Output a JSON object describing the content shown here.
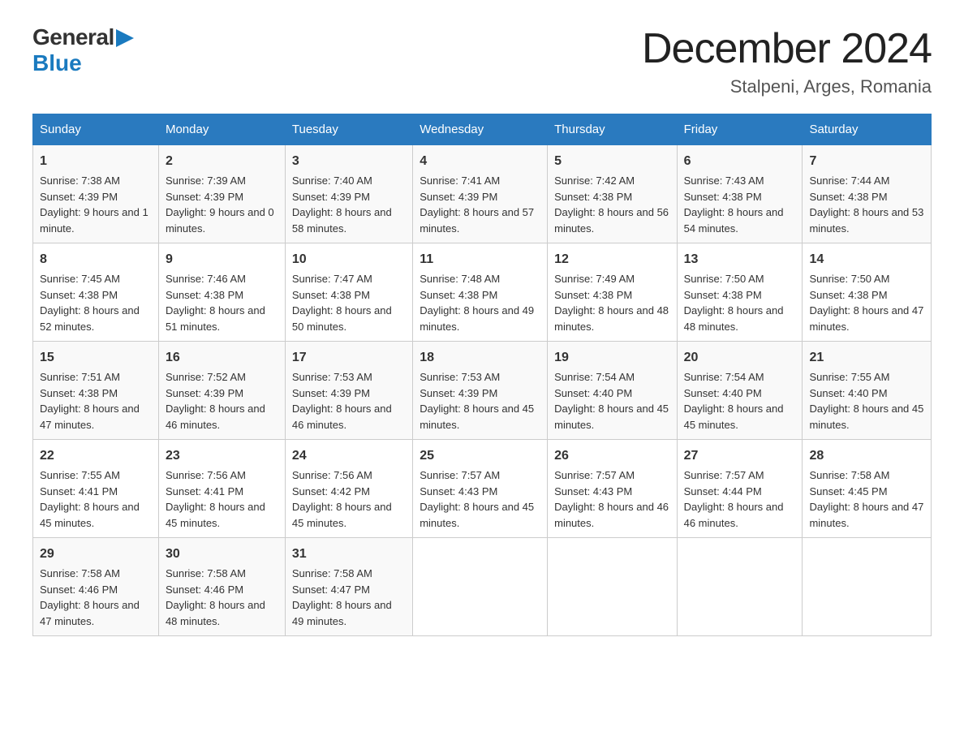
{
  "header": {
    "logo": {
      "general": "General",
      "blue": "Blue",
      "arrow": "▶"
    },
    "title": "December 2024",
    "location": "Stalpeni, Arges, Romania"
  },
  "days_of_week": [
    "Sunday",
    "Monday",
    "Tuesday",
    "Wednesday",
    "Thursday",
    "Friday",
    "Saturday"
  ],
  "weeks": [
    [
      {
        "day": "1",
        "sunrise": "7:38 AM",
        "sunset": "4:39 PM",
        "daylight": "9 hours and 1 minute."
      },
      {
        "day": "2",
        "sunrise": "7:39 AM",
        "sunset": "4:39 PM",
        "daylight": "9 hours and 0 minutes."
      },
      {
        "day": "3",
        "sunrise": "7:40 AM",
        "sunset": "4:39 PM",
        "daylight": "8 hours and 58 minutes."
      },
      {
        "day": "4",
        "sunrise": "7:41 AM",
        "sunset": "4:39 PM",
        "daylight": "8 hours and 57 minutes."
      },
      {
        "day": "5",
        "sunrise": "7:42 AM",
        "sunset": "4:38 PM",
        "daylight": "8 hours and 56 minutes."
      },
      {
        "day": "6",
        "sunrise": "7:43 AM",
        "sunset": "4:38 PM",
        "daylight": "8 hours and 54 minutes."
      },
      {
        "day": "7",
        "sunrise": "7:44 AM",
        "sunset": "4:38 PM",
        "daylight": "8 hours and 53 minutes."
      }
    ],
    [
      {
        "day": "8",
        "sunrise": "7:45 AM",
        "sunset": "4:38 PM",
        "daylight": "8 hours and 52 minutes."
      },
      {
        "day": "9",
        "sunrise": "7:46 AM",
        "sunset": "4:38 PM",
        "daylight": "8 hours and 51 minutes."
      },
      {
        "day": "10",
        "sunrise": "7:47 AM",
        "sunset": "4:38 PM",
        "daylight": "8 hours and 50 minutes."
      },
      {
        "day": "11",
        "sunrise": "7:48 AM",
        "sunset": "4:38 PM",
        "daylight": "8 hours and 49 minutes."
      },
      {
        "day": "12",
        "sunrise": "7:49 AM",
        "sunset": "4:38 PM",
        "daylight": "8 hours and 48 minutes."
      },
      {
        "day": "13",
        "sunrise": "7:50 AM",
        "sunset": "4:38 PM",
        "daylight": "8 hours and 48 minutes."
      },
      {
        "day": "14",
        "sunrise": "7:50 AM",
        "sunset": "4:38 PM",
        "daylight": "8 hours and 47 minutes."
      }
    ],
    [
      {
        "day": "15",
        "sunrise": "7:51 AM",
        "sunset": "4:38 PM",
        "daylight": "8 hours and 47 minutes."
      },
      {
        "day": "16",
        "sunrise": "7:52 AM",
        "sunset": "4:39 PM",
        "daylight": "8 hours and 46 minutes."
      },
      {
        "day": "17",
        "sunrise": "7:53 AM",
        "sunset": "4:39 PM",
        "daylight": "8 hours and 46 minutes."
      },
      {
        "day": "18",
        "sunrise": "7:53 AM",
        "sunset": "4:39 PM",
        "daylight": "8 hours and 45 minutes."
      },
      {
        "day": "19",
        "sunrise": "7:54 AM",
        "sunset": "4:40 PM",
        "daylight": "8 hours and 45 minutes."
      },
      {
        "day": "20",
        "sunrise": "7:54 AM",
        "sunset": "4:40 PM",
        "daylight": "8 hours and 45 minutes."
      },
      {
        "day": "21",
        "sunrise": "7:55 AM",
        "sunset": "4:40 PM",
        "daylight": "8 hours and 45 minutes."
      }
    ],
    [
      {
        "day": "22",
        "sunrise": "7:55 AM",
        "sunset": "4:41 PM",
        "daylight": "8 hours and 45 minutes."
      },
      {
        "day": "23",
        "sunrise": "7:56 AM",
        "sunset": "4:41 PM",
        "daylight": "8 hours and 45 minutes."
      },
      {
        "day": "24",
        "sunrise": "7:56 AM",
        "sunset": "4:42 PM",
        "daylight": "8 hours and 45 minutes."
      },
      {
        "day": "25",
        "sunrise": "7:57 AM",
        "sunset": "4:43 PM",
        "daylight": "8 hours and 45 minutes."
      },
      {
        "day": "26",
        "sunrise": "7:57 AM",
        "sunset": "4:43 PM",
        "daylight": "8 hours and 46 minutes."
      },
      {
        "day": "27",
        "sunrise": "7:57 AM",
        "sunset": "4:44 PM",
        "daylight": "8 hours and 46 minutes."
      },
      {
        "day": "28",
        "sunrise": "7:58 AM",
        "sunset": "4:45 PM",
        "daylight": "8 hours and 47 minutes."
      }
    ],
    [
      {
        "day": "29",
        "sunrise": "7:58 AM",
        "sunset": "4:46 PM",
        "daylight": "8 hours and 47 minutes."
      },
      {
        "day": "30",
        "sunrise": "7:58 AM",
        "sunset": "4:46 PM",
        "daylight": "8 hours and 48 minutes."
      },
      {
        "day": "31",
        "sunrise": "7:58 AM",
        "sunset": "4:47 PM",
        "daylight": "8 hours and 49 minutes."
      },
      null,
      null,
      null,
      null
    ]
  ],
  "labels": {
    "sunrise": "Sunrise:",
    "sunset": "Sunset:",
    "daylight": "Daylight:"
  }
}
